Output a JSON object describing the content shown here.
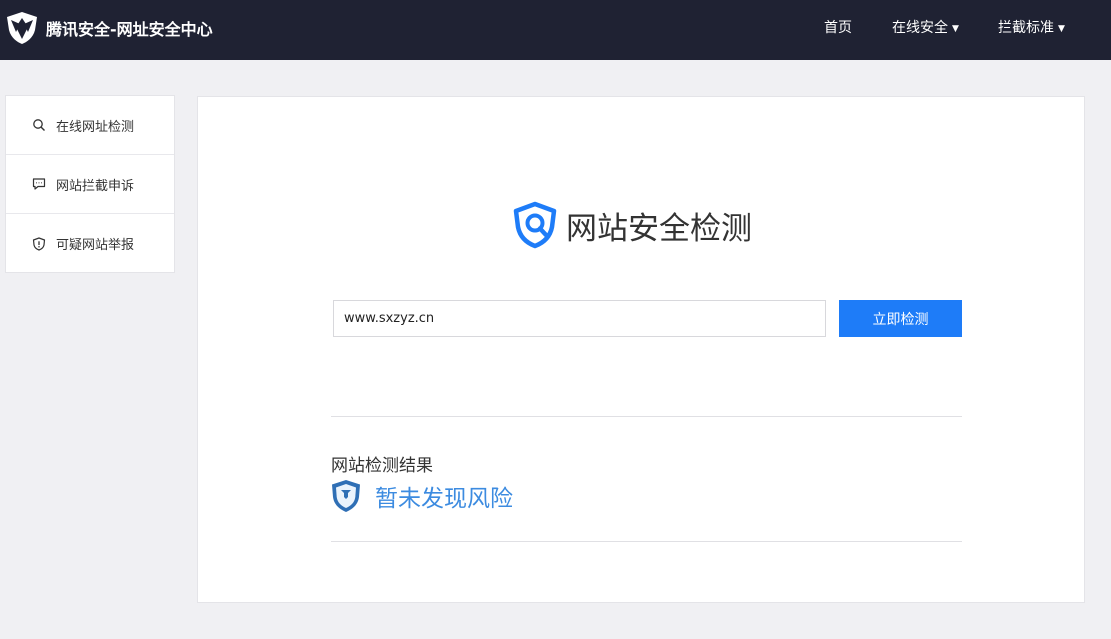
{
  "header": {
    "brand_title": "腾讯安全-网址安全中心",
    "nav": [
      {
        "label": "首页",
        "dropdown": false
      },
      {
        "label": "在线安全",
        "dropdown": true
      },
      {
        "label": "拦截标准",
        "dropdown": true
      }
    ],
    "caret": "▼"
  },
  "sidebar": {
    "items": [
      {
        "label": "在线网址检测",
        "icon": "search-icon"
      },
      {
        "label": "网站拦截申诉",
        "icon": "chat-icon"
      },
      {
        "label": "可疑网站举报",
        "icon": "shield-alert-icon"
      }
    ]
  },
  "main": {
    "title": "网站安全检测",
    "url_value": "www.sxzyz.cn",
    "check_button": "立即检测",
    "result_label": "网站检测结果",
    "result_status": "暂未发现风险"
  },
  "colors": {
    "topbar": "#1f2233",
    "accent": "#1e7cf8",
    "result_blue": "#3c8be0"
  }
}
